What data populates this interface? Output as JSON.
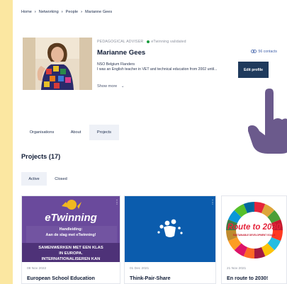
{
  "breadcrumb": [
    "Home",
    "Networking",
    "People",
    "Marianne Gees"
  ],
  "profile": {
    "role": "PEDAGOGICAL ADVISER",
    "status": "eTwinning validated",
    "name": "Marianne Gees",
    "organisation": "NSO Belgium Flanders",
    "bio": "I was an English teacher in VET and technical education from 2002 until...",
    "show_more": "Show more",
    "contacts": "56 contacts",
    "edit_profile": "Edit profile"
  },
  "tabs": [
    "Organisations",
    "About",
    "Projects"
  ],
  "active_tab": "Projects",
  "projects": {
    "heading": "Projects (17)",
    "subtabs": [
      "Active",
      "Closed"
    ],
    "active_subtab": "Active",
    "cards": [
      {
        "date": "08 Nov 2022",
        "title": "European School Education",
        "image_text": {
          "brand": "eTwinning",
          "line1": "Handleiding:",
          "line2": "Aan de slag met eTwinning!",
          "line3": "SAMENWERKEN MET EEN KLAS",
          "line4": "IN EUROPA.",
          "line5": "INTERNATIONALISEREN KAN"
        }
      },
      {
        "date": "01 Dec 2021",
        "title": "Think-Pair-Share"
      },
      {
        "date": "21 Nov 2021",
        "title": "En route to 2030!",
        "image_text": {
          "brand": "Route to 2030",
          "sub": "SUSTAINABLE DEVELOPMENT GOALS"
        }
      }
    ]
  },
  "colors": {
    "background": "#fbe7a1",
    "primary": "#1f3a5c",
    "hand": "#6b5a8c",
    "etwinning_purple": "#6a4a9c",
    "blue_card": "#0b5cad",
    "status_green": "#1a9c3e"
  }
}
